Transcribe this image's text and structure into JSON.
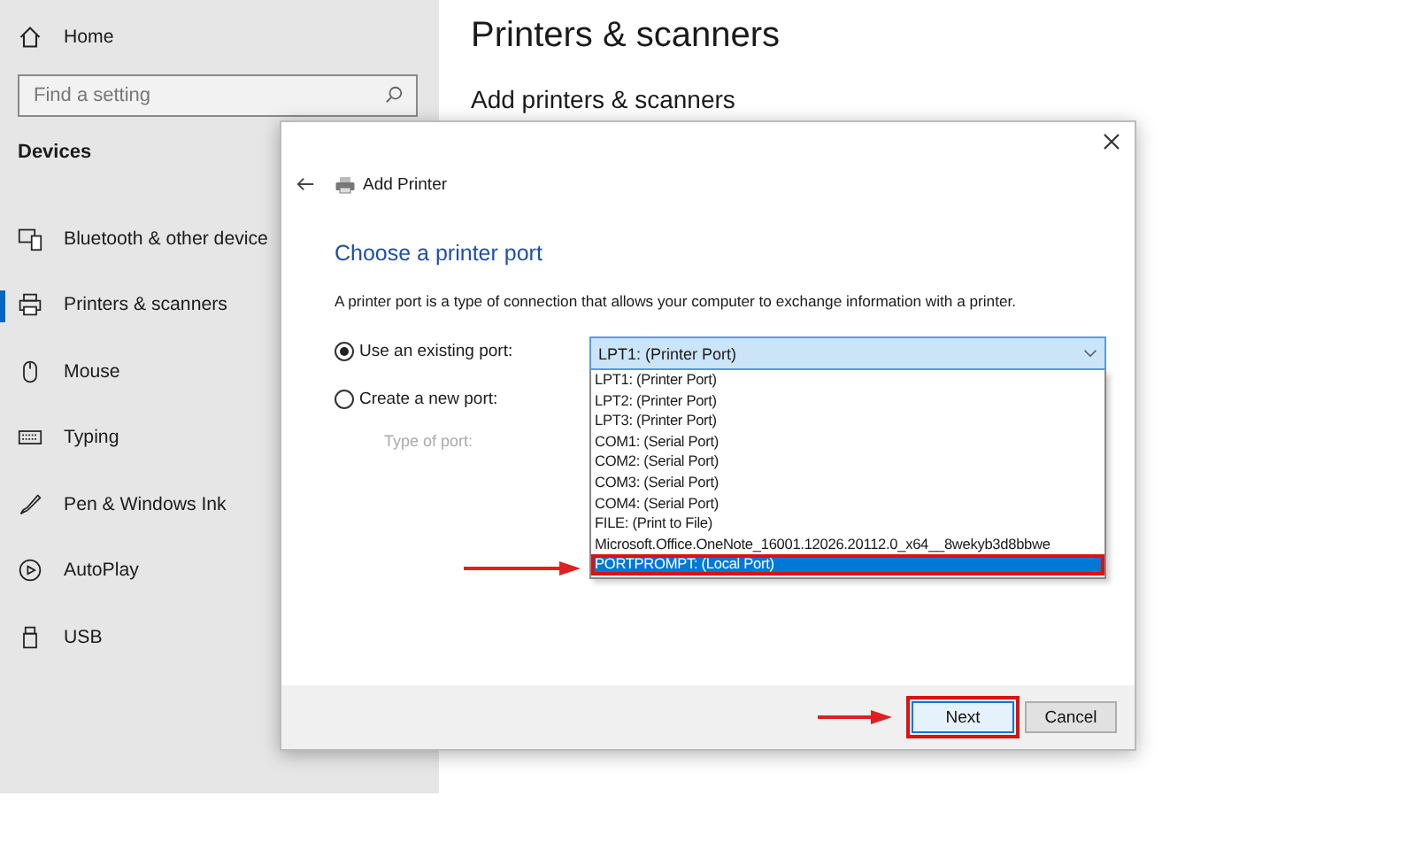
{
  "sidebar": {
    "home": "Home",
    "search": {
      "placeholder": "Find a setting"
    },
    "section": "Devices",
    "items": [
      {
        "label": "Bluetooth & other device",
        "selected": false
      },
      {
        "label": "Printers & scanners",
        "selected": true
      },
      {
        "label": "Mouse",
        "selected": false
      },
      {
        "label": "Typing",
        "selected": false
      },
      {
        "label": "Pen & Windows Ink",
        "selected": false
      },
      {
        "label": "AutoPlay",
        "selected": false
      },
      {
        "label": "USB",
        "selected": false
      }
    ]
  },
  "page": {
    "title": "Printers & scanners",
    "subtitle": "Add printers & scanners"
  },
  "dialog": {
    "title": "Add Printer",
    "heading": "Choose a printer port",
    "description": "A printer port is a type of connection that allows your computer to exchange information with a printer.",
    "options": [
      {
        "label": "Use an existing port:",
        "selected": true
      },
      {
        "label": "Create a new port:",
        "selected": false
      }
    ],
    "type_of_port": {
      "label": "Type of port:",
      "disabled": true
    },
    "port_combo": {
      "value": "LPT1: (Printer Port)",
      "expanded": true
    },
    "port_list": [
      {
        "label": "LPT1: (Printer Port)",
        "selected": false
      },
      {
        "label": "LPT2: (Printer Port)",
        "selected": false
      },
      {
        "label": "LPT3: (Printer Port)",
        "selected": false
      },
      {
        "label": "COM1: (Serial Port)",
        "selected": false
      },
      {
        "label": "COM2: (Serial Port)",
        "selected": false
      },
      {
        "label": "COM3: (Serial Port)",
        "selected": false
      },
      {
        "label": "COM4: (Serial Port)",
        "selected": false
      },
      {
        "label": "FILE: (Print to File)",
        "selected": false
      },
      {
        "label": "Microsoft.Office.OneNote_16001.12026.20112.0_x64__8wekyb3d8bbwe",
        "selected": false
      },
      {
        "label": "PORTPROMPT: (Local Port)",
        "selected": true
      }
    ],
    "buttons": [
      {
        "label": "Next",
        "highlighted": true
      },
      {
        "label": "Cancel",
        "highlighted": false
      }
    ]
  }
}
